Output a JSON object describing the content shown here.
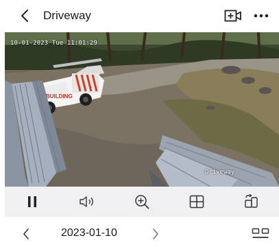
{
  "header": {
    "title": "Driveway",
    "back_icon": "chevron-left-icon",
    "add_icon": "add-camera-icon",
    "more_icon": "more-horizontal-icon"
  },
  "video": {
    "timestamp": "10-01-2023 Tue 11:01:29",
    "camera_name": "Driveway"
  },
  "controls": [
    {
      "name": "pause-button",
      "icon": "pause-icon"
    },
    {
      "name": "volume-button",
      "icon": "speaker-icon"
    },
    {
      "name": "zoom-button",
      "icon": "zoom-in-icon"
    },
    {
      "name": "grid-button",
      "icon": "grid-icon"
    },
    {
      "name": "rotate-button",
      "icon": "rotate-screen-icon"
    }
  ],
  "datebar": {
    "date": "2023-01-10",
    "prev_icon": "chevron-left-icon",
    "next_icon": "chevron-right-icon",
    "layout_icon": "layout-icon"
  }
}
